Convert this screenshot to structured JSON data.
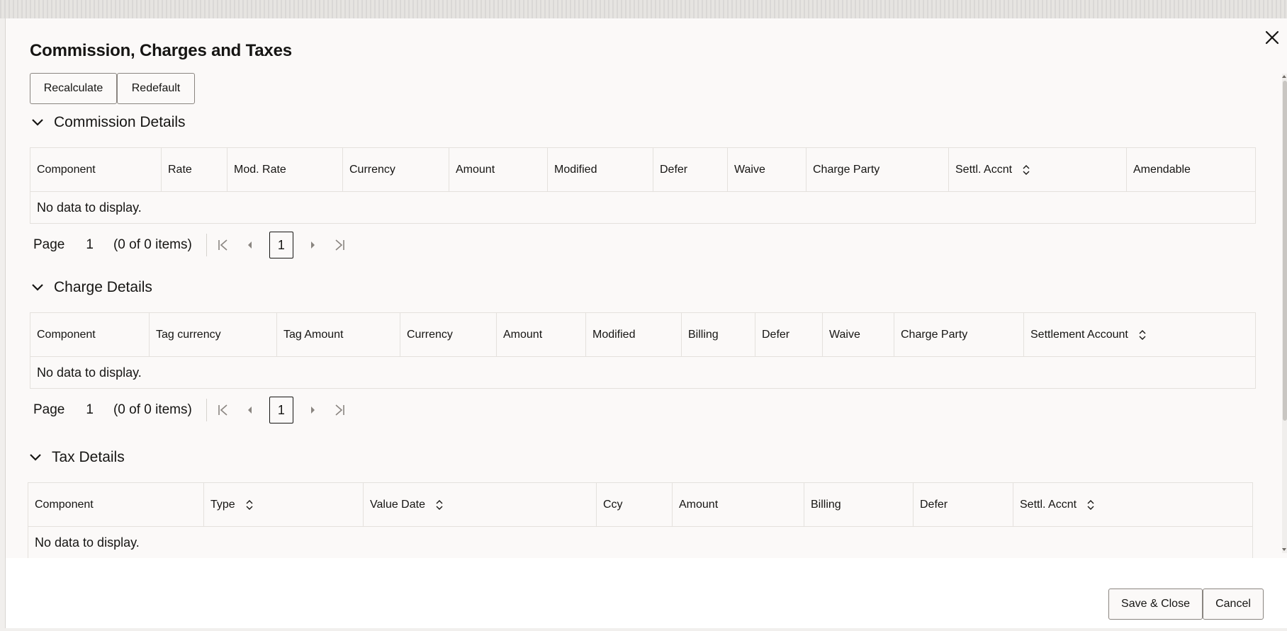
{
  "dialog": {
    "title": "Commission, Charges and Taxes",
    "recalculate_label": "Recalculate",
    "redefault_label": "Redefault",
    "save_close_label": "Save & Close",
    "cancel_label": "Cancel"
  },
  "commission": {
    "title": "Commission Details",
    "columns": [
      "Component",
      "Rate",
      "Mod. Rate",
      "Currency",
      "Amount",
      "Modified",
      "Defer",
      "Waive",
      "Charge Party",
      "Settl. Accnt",
      "Amendable"
    ],
    "empty_text": "No data to display.",
    "pager": {
      "label": "Page",
      "page": "1",
      "items": "(0 of 0 items)",
      "current": "1"
    }
  },
  "charge": {
    "title": "Charge Details",
    "columns": [
      "Component",
      "Tag currency",
      "Tag Amount",
      "Currency",
      "Amount",
      "Modified",
      "Billing",
      "Defer",
      "Waive",
      "Charge Party",
      "Settlement Account"
    ],
    "empty_text": "No data to display.",
    "pager": {
      "label": "Page",
      "page": "1",
      "items": "(0 of 0 items)",
      "current": "1"
    }
  },
  "tax": {
    "title": "Tax Details",
    "columns": [
      "Component",
      "Type",
      "Value Date",
      "Ccy",
      "Amount",
      "Billing",
      "Defer",
      "Settl. Accnt"
    ],
    "empty_text": "No data to display."
  }
}
